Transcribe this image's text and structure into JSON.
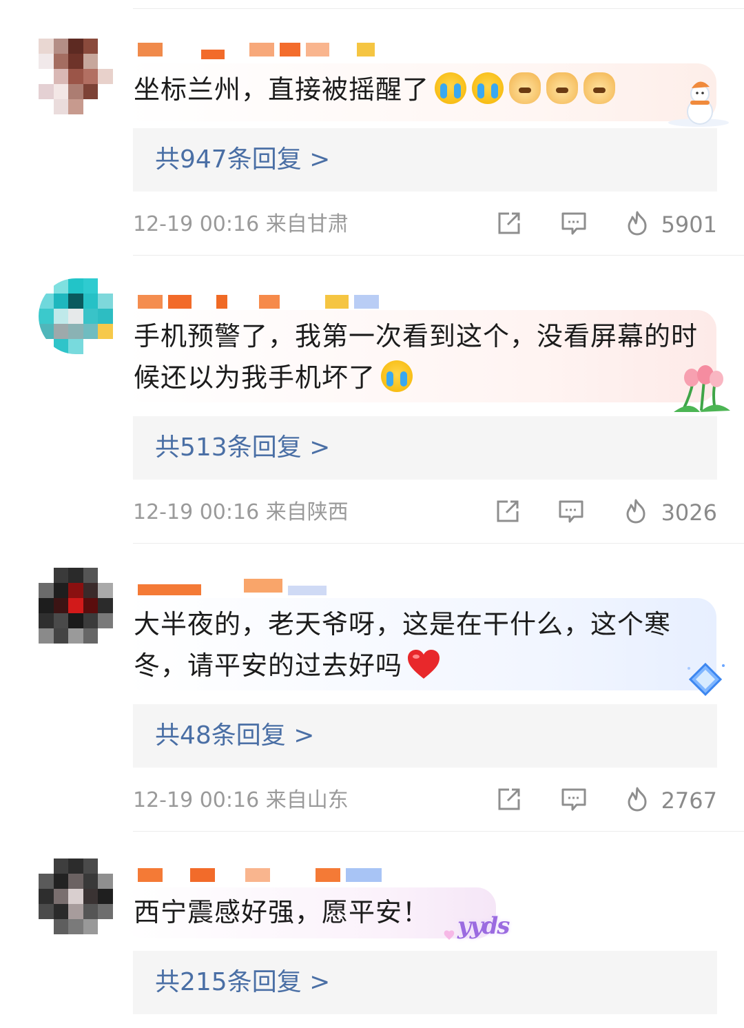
{
  "comments": [
    {
      "text": "坐标兰州，直接被摇醒了",
      "replies": "共947条回复 >",
      "time": "12-19 00:16",
      "location": "来自甘肃",
      "likes": "5901",
      "emoji": [
        "crying-face",
        "crying-face",
        "crying-dog",
        "crying-dog",
        "crying-dog"
      ]
    },
    {
      "text": "手机预警了，我第一次看到这个，没看屏幕的时候还以为我手机坏了",
      "replies": "共513条回复 >",
      "time": "12-19 00:16",
      "location": "来自陕西",
      "likes": "3026",
      "emoji": [
        "crying-face"
      ]
    },
    {
      "text": "大半夜的，老天爷呀，这是在干什么，这个寒冬，请平安的过去好吗",
      "replies": "共48条回复 >",
      "time": "12-19 00:16",
      "location": "来自山东",
      "likes": "2767",
      "emoji": [
        "red-heart"
      ]
    },
    {
      "text": "西宁震感好强，愿平安！",
      "replies": "共215条回复 >",
      "emoji": []
    }
  ],
  "decorations": {
    "snowman": "snowman-badge",
    "tulips": "tulip-badge",
    "diamond": "diamond-badge",
    "yyds": "yyds"
  },
  "icons": [
    "share-icon",
    "comment-icon",
    "like-fire-icon"
  ]
}
